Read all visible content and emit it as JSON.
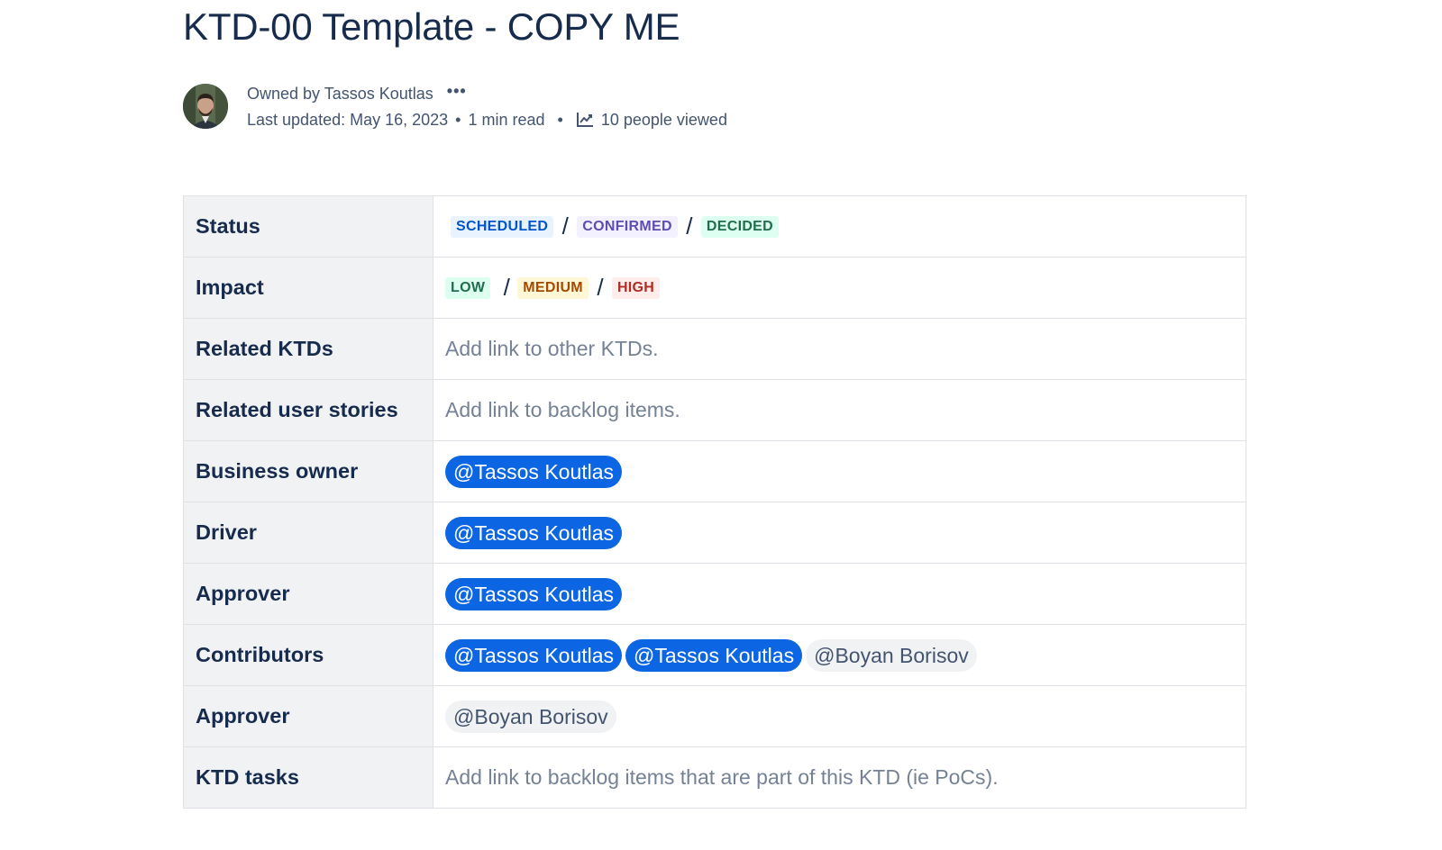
{
  "page": {
    "title": "KTD-00 Template - COPY ME"
  },
  "byline": {
    "owned_by": "Owned by Tassos Koutlas",
    "more_icon": "ellipsis-icon",
    "last_updated": "Last updated: May 16, 2023",
    "read_time": "1 min read",
    "views": "10 people viewed",
    "views_icon": "analytics-chart-icon"
  },
  "colors": {
    "blue_lozenge_bg": "#e9f2ff",
    "blue_lozenge_fg": "#0055cc",
    "purple_lozenge_bg": "#f3f0ff",
    "purple_lozenge_fg": "#5e4db2",
    "green_lozenge_bg": "#dcfff1",
    "green_lozenge_fg": "#216e4e",
    "yellow_lozenge_bg": "#fff7d6",
    "yellow_lozenge_fg": "#a54800",
    "red_lozenge_bg": "#ffeceb",
    "red_lozenge_fg": "#ae2e24",
    "mention_self_bg": "#0c66e4"
  },
  "table": {
    "status": {
      "label": "Status",
      "values": [
        "SCHEDULED",
        "CONFIRMED",
        "DECIDED"
      ],
      "separator": "/"
    },
    "impact": {
      "label": "Impact",
      "values": [
        "LOW",
        "MEDIUM",
        "HIGH"
      ],
      "separator": "/"
    },
    "related_ktds": {
      "label": "Related KTDs",
      "placeholder": "Add link to other KTDs."
    },
    "related_user_stories": {
      "label": "Related user stories",
      "placeholder": "Add link to backlog items."
    },
    "business_owner": {
      "label": "Business owner",
      "mention": "@Tassos Koutlas"
    },
    "driver": {
      "label": "Driver",
      "mention": "@Tassos Koutlas"
    },
    "approver": {
      "label": "Approver",
      "mention": "@Tassos Koutlas"
    },
    "contributors": {
      "label": "Contributors",
      "mentions": [
        "@Tassos Koutlas",
        "@Tassos Koutlas",
        "@Boyan Borisov"
      ]
    },
    "approver2": {
      "label": "Approver",
      "mention": "@Boyan Borisov"
    },
    "ktd_tasks": {
      "label": "KTD tasks",
      "placeholder": "Add link to backlog items that are part of this KTD (ie PoCs)."
    }
  }
}
